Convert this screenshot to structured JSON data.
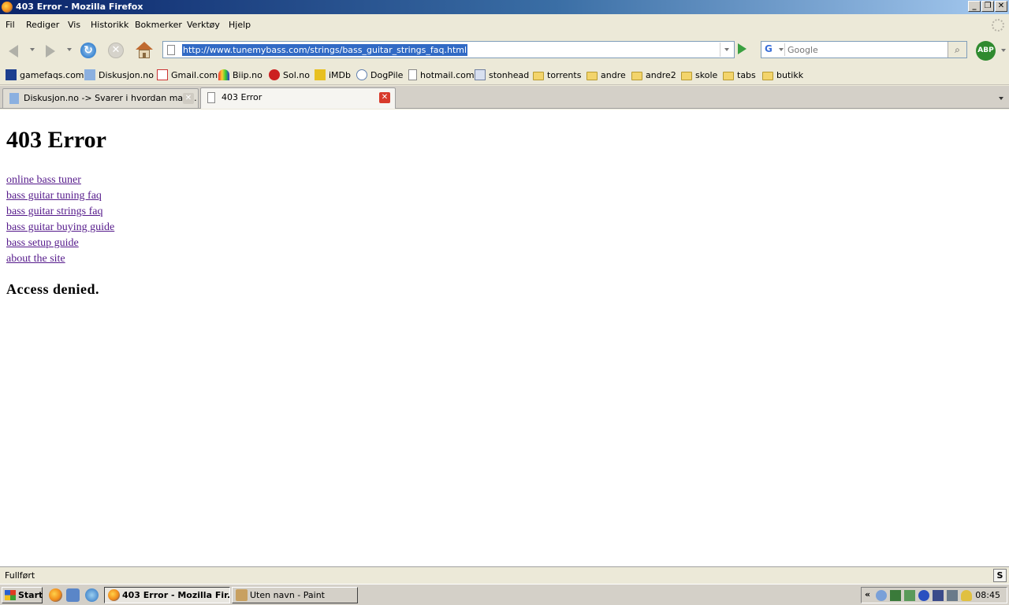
{
  "window": {
    "title": "403 Error - Mozilla Firefox",
    "buttons": {
      "minimize": "_",
      "maximize": "❐",
      "close": "✕"
    }
  },
  "menu": {
    "items": [
      "Fil",
      "Rediger",
      "Vis",
      "Historikk",
      "Bokmerker",
      "Verktøy",
      "Hjelp"
    ]
  },
  "navbar": {
    "url": "http://www.tunemybass.com/strings/bass_guitar_strings_faq.html",
    "search_placeholder": "Google",
    "search_engine_icon": "google-icon",
    "abp_label": "ABP",
    "reload_glyph": "↻",
    "stop_glyph": "✕"
  },
  "bookmarks": [
    {
      "label": "gamefaqs.com",
      "icon": "gamefaqs-icon"
    },
    {
      "label": "Diskusjon.no",
      "icon": "diskusjon-icon"
    },
    {
      "label": "Gmail.com",
      "icon": "gmail-icon"
    },
    {
      "label": "Biip.no",
      "icon": "biip-icon"
    },
    {
      "label": "Sol.no",
      "icon": "sol-icon"
    },
    {
      "label": "iMDb",
      "icon": "imdb-icon"
    },
    {
      "label": "DogPile",
      "icon": "dogpile-icon"
    },
    {
      "label": "hotmail.com",
      "icon": "page-icon"
    },
    {
      "label": "stonhead",
      "icon": "stonhead-icon"
    },
    {
      "label": "torrents",
      "icon": "folder-icon"
    },
    {
      "label": "andre",
      "icon": "folder-icon"
    },
    {
      "label": "andre2",
      "icon": "folder-icon"
    },
    {
      "label": "skole",
      "icon": "folder-icon"
    },
    {
      "label": "tabs",
      "icon": "folder-icon"
    },
    {
      "label": "butikk",
      "icon": "folder-icon"
    }
  ],
  "tabs": [
    {
      "label": "Diskusjon.no -> Svarer i hvordan man...",
      "active": false
    },
    {
      "label": "403 Error",
      "active": true
    }
  ],
  "page": {
    "heading": "403 Error",
    "links": [
      "online bass tuner",
      "bass guitar tuning faq",
      "bass guitar strings faq",
      "bass guitar buying guide",
      "bass setup guide",
      "about the site"
    ],
    "message": "Access denied."
  },
  "status": {
    "text": "Fullført",
    "icon_glyph": "S"
  },
  "taskbar": {
    "start_label": "Start",
    "items": [
      {
        "label": "403 Error - Mozilla Fir...",
        "active": true
      },
      {
        "label": "Uten navn - Paint",
        "active": false
      }
    ],
    "tray_chevron": "«",
    "clock": "08:45"
  },
  "colors": {
    "link_visited": "#551a8b",
    "title_bar_start": "#0a246a",
    "selection": "#316ac5"
  }
}
